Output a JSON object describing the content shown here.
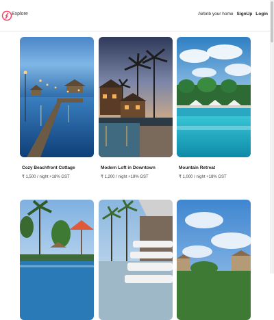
{
  "nav": {
    "explore_label": "Explore",
    "airbnb_home_label": "Airbnb your home",
    "signup_label": "SignUp",
    "login_label": "Login",
    "brand_color": "#ff385c"
  },
  "listings": [
    {
      "title": "Cozy Beachfront Cottage",
      "price": "₹ 1,500 / night +18% GST"
    },
    {
      "title": "Modern Loft in Downtown",
      "price": "₹ 1,200 / night +18% GST"
    },
    {
      "title": "Mountain Retreat",
      "price": "₹ 1,000 / night +18% GST"
    },
    {
      "title": "",
      "price": ""
    },
    {
      "title": "",
      "price": ""
    },
    {
      "title": "",
      "price": ""
    }
  ]
}
